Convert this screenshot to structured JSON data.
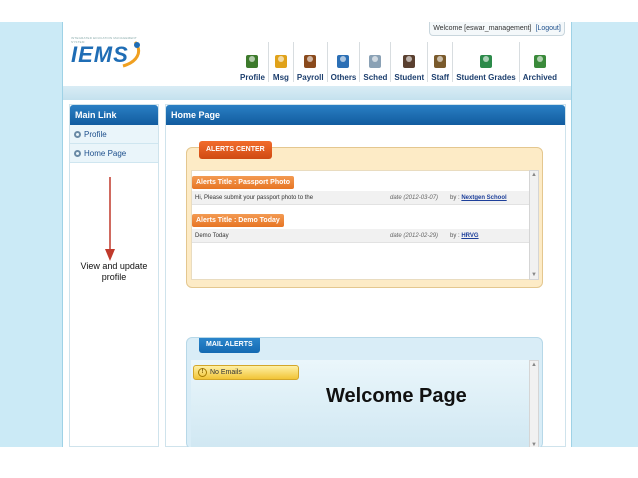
{
  "header": {
    "welcome_text": "Welcome [eswar_management]",
    "logout_label": "[Logout]",
    "logo_text": "IEMS",
    "logo_tagline": "INTEGRATED EDUCATION MANAGEMENT SYSTEM"
  },
  "nav": {
    "items": [
      {
        "label": "Profile",
        "icon": "profile-icon",
        "color": "#3d7a2c"
      },
      {
        "label": "Msg",
        "icon": "message-icon",
        "color": "#e0a21a"
      },
      {
        "label": "Payroll",
        "icon": "payroll-icon",
        "color": "#8a4a1c"
      },
      {
        "label": "Others",
        "icon": "others-icon",
        "color": "#2c6fb5"
      },
      {
        "label": "Sched",
        "icon": "schedule-icon",
        "color": "#8aa1b5"
      },
      {
        "label": "Student",
        "icon": "student-icon",
        "color": "#5a4030"
      },
      {
        "label": "Staff",
        "icon": "staff-icon",
        "color": "#7a5a2c"
      },
      {
        "label": "Student Grades",
        "icon": "grades-icon",
        "color": "#2c8a4a"
      },
      {
        "label": "Archived",
        "icon": "archived-icon",
        "color": "#3a8a3a"
      }
    ]
  },
  "sidebar": {
    "title": "Main Link",
    "items": [
      {
        "label": "Profile"
      },
      {
        "label": "Home Page"
      }
    ],
    "note": "View and update profile"
  },
  "main": {
    "title": "Home Page",
    "alerts": {
      "tab_label": "ALERTS CENTER",
      "items": [
        {
          "title": "Alerts Title : Passport Photo",
          "message": "Hi, Please submit your passport photo to the",
          "date": "date (2012-03-07)",
          "by_label": "by :",
          "by_name": "Nextgen School"
        },
        {
          "title": "Alerts Title : Demo Today",
          "message": "Demo Today",
          "date": "date (2012-02-29)",
          "by_label": "by :",
          "by_name": "HRVG"
        }
      ]
    },
    "mail": {
      "tab_label": "MAIL ALERTS",
      "empty_label": "No Emails"
    }
  },
  "caption": "Welcome Page",
  "colors": {
    "accent_blue": "#1a6cb0",
    "alert_orange": "#e8641f",
    "background_band": "#cbeaf6"
  }
}
